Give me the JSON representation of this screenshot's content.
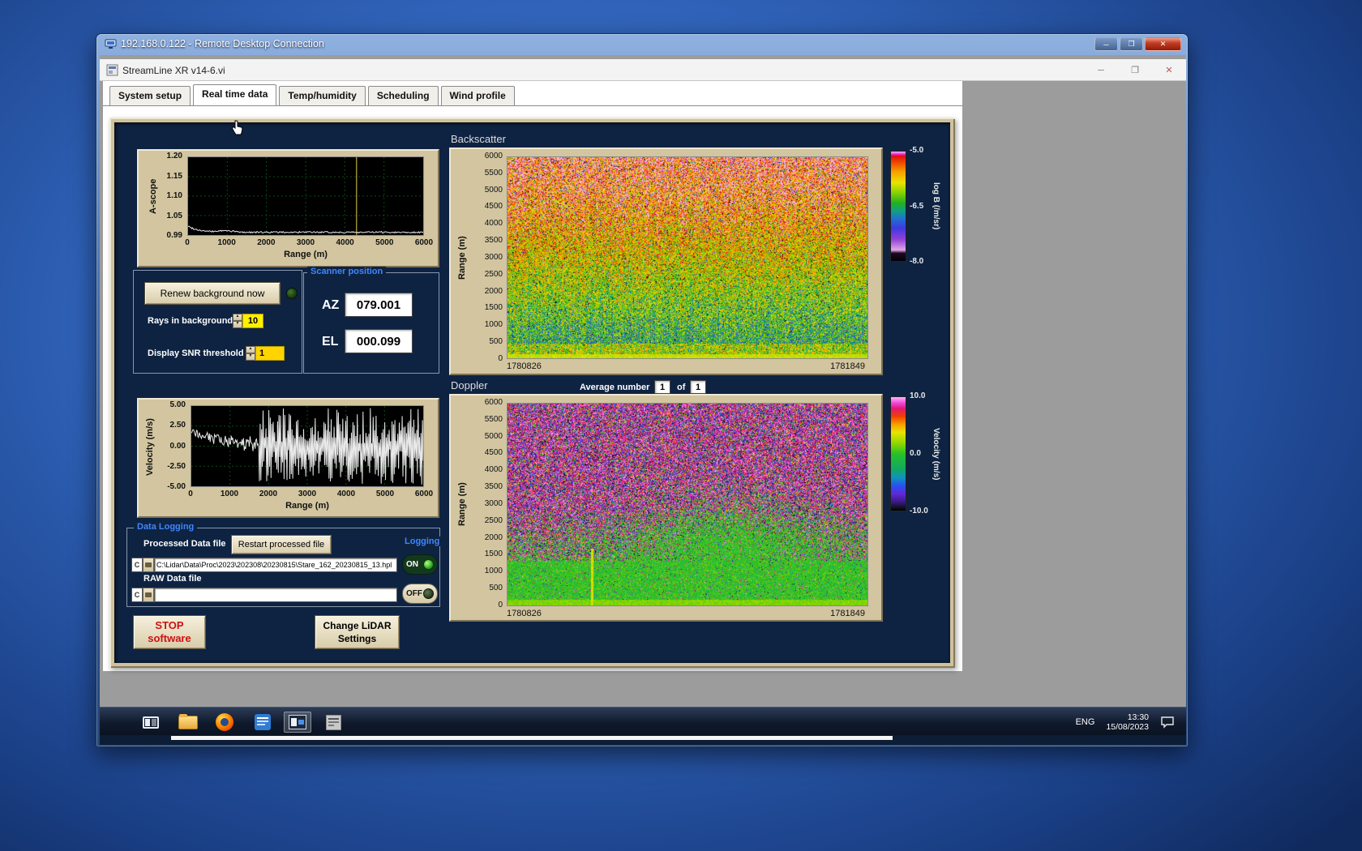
{
  "rdp": {
    "title": "192.168.0.122 - Remote Desktop Connection"
  },
  "window_controls": {
    "minimize": "─",
    "maximize": "❐",
    "close": "✕"
  },
  "app": {
    "title": "StreamLine XR v14-6.vi",
    "tabs": [
      "System setup",
      "Real time data",
      "Temp/humidity",
      "Scheduling",
      "Wind profile"
    ],
    "active_tab_index": 1
  },
  "ascope": {
    "ylabel": "A-scope",
    "xlabel": "Range (m)",
    "yticks": [
      "1.20",
      "1.15",
      "1.10",
      "1.05",
      "0.99"
    ],
    "xticks": [
      "0",
      "1000",
      "2000",
      "3000",
      "4000",
      "5000",
      "6000"
    ]
  },
  "background_controls": {
    "renew_button": "Renew background now",
    "rays_label": "Rays in background",
    "rays_value": "10",
    "snr_label": "Display SNR threshold",
    "snr_value": "1"
  },
  "scanner": {
    "title": "Scanner position",
    "az_label": "AZ",
    "az_value": "079.001",
    "el_label": "EL",
    "el_value": "000.099"
  },
  "backscatter": {
    "title": "Backscatter",
    "ylabel": "Range (m)",
    "yticks": [
      "6000",
      "5500",
      "5000",
      "4500",
      "4000",
      "3500",
      "3000",
      "2500",
      "2000",
      "1500",
      "1000",
      "500",
      "0"
    ],
    "x_start": "1780826",
    "x_end": "1781849",
    "colorbar_label": "log B (/m/sr)",
    "colorbar_ticks": [
      "-5.0",
      "-6.5",
      "-8.0"
    ]
  },
  "doppler": {
    "title": "Doppler",
    "average_label": "Average number",
    "average_value": "1",
    "of_label": "of",
    "of_value": "1",
    "ylabel": "Range (m)",
    "yticks": [
      "6000",
      "5500",
      "5000",
      "4500",
      "4000",
      "3500",
      "3000",
      "2500",
      "2000",
      "1500",
      "1000",
      "500",
      "0"
    ],
    "x_start": "1780826",
    "x_end": "1781849",
    "colorbar_label": "Velocity (m/s)",
    "colorbar_ticks": [
      "10.0",
      "0.0",
      "-10.0"
    ]
  },
  "velocity_plot": {
    "ylabel": "Velocity (m/s)",
    "xlabel": "Range (m)",
    "yticks": [
      "5.00",
      "2.50",
      "0.00",
      "-2.50",
      "-5.00"
    ],
    "xticks": [
      "0",
      "1000",
      "2000",
      "3000",
      "4000",
      "5000",
      "6000"
    ]
  },
  "data_logging": {
    "title": "Data Logging",
    "processed_label": "Processed Data file",
    "restart_button": "Restart processed file",
    "logging_label": "Logging",
    "processed_drive": "C",
    "processed_path": "C:\\Lidar\\Data\\Proc\\2023\\202308\\20230815\\Stare_162_20230815_13.hpl",
    "raw_label": "RAW Data file",
    "raw_drive": "C",
    "raw_path": "",
    "on_label": "ON",
    "off_label": "OFF"
  },
  "actions": {
    "stop_line1": "STOP",
    "stop_line2": "software",
    "change_line1": "Change LiDAR",
    "change_line2": "Settings"
  },
  "taskbar": {
    "lang": "ENG",
    "time": "13:30",
    "date": "15/08/2023"
  },
  "chart_data": [
    {
      "id": "ascope",
      "type": "line",
      "xlabel": "Range (m)",
      "ylabel": "A-scope",
      "xlim": [
        0,
        6000
      ],
      "ylim": [
        0.99,
        1.2
      ],
      "cursor_x": 4300,
      "description": "Near-flat noisy intensity trace around 1.00 with a yellow cursor line near 4300 m"
    },
    {
      "id": "velocity",
      "type": "line",
      "xlabel": "Range (m)",
      "ylabel": "Velocity (m/s)",
      "xlim": [
        0,
        6000
      ],
      "ylim": [
        -5,
        5
      ],
      "signal_range_m": [
        0,
        1750
      ],
      "description": "Coherent velocity near 0 m/s up to ~1750 m, then saturated noise spanning full ±5 m/s"
    },
    {
      "id": "backscatter",
      "type": "heatmap",
      "ylim": [
        0,
        6000
      ],
      "x_start": 1780826,
      "x_end": 1781849,
      "value_label": "log B (/m/sr)",
      "value_range": [
        -8,
        -5
      ],
      "colormap": [
        [
          -8.35,
          "#050008"
        ],
        [
          -8.1,
          "#1a0a20"
        ],
        [
          -8.0,
          "#e2a6e8"
        ],
        [
          -7.65,
          "#9040d8"
        ],
        [
          -7.3,
          "#4038e0"
        ],
        [
          -7.0,
          "#2070d0"
        ],
        [
          -6.75,
          "#10a080"
        ],
        [
          -6.5,
          "#22b022"
        ],
        [
          -6.15,
          "#8cd400"
        ],
        [
          -5.85,
          "#e8e400"
        ],
        [
          -5.5,
          "#f8a000"
        ],
        [
          -5.2,
          "#f04800"
        ],
        [
          -5.0,
          "#e01010"
        ],
        [
          -4.95,
          "#e818a8"
        ],
        [
          -4.85,
          "#ffb4ff"
        ]
      ],
      "description": "Attenuated backscatter: red/orange noise aloft grading to green below ~2000 m with bright yellow band near the ground"
    },
    {
      "id": "doppler",
      "type": "heatmap",
      "ylim": [
        0,
        6000
      ],
      "x_start": 1780826,
      "x_end": 1781849,
      "value_label": "Velocity (m/s)",
      "value_range": [
        -10,
        10
      ],
      "colormap": [
        [
          -10.6,
          "#000000"
        ],
        [
          -10.0,
          "#101028"
        ],
        [
          -9.0,
          "#3a1a80"
        ],
        [
          -7.5,
          "#6028d8"
        ],
        [
          -6.0,
          "#2850f0"
        ],
        [
          -4.5,
          "#1090c0"
        ],
        [
          -3.0,
          "#10a868"
        ],
        [
          0.0,
          "#28c028"
        ],
        [
          2.0,
          "#90d800"
        ],
        [
          4.0,
          "#e8e400"
        ],
        [
          5.5,
          "#f8a000"
        ],
        [
          7.0,
          "#f04000"
        ],
        [
          8.5,
          "#e01878"
        ],
        [
          9.5,
          "#f048d8"
        ],
        [
          10.6,
          "#ffb4ff"
        ]
      ],
      "description": "Doppler velocity: magenta/violet noise aloft, green near-zero velocities below ~2500 m and near the ground, thin updraft streak near 1/4 width"
    }
  ]
}
